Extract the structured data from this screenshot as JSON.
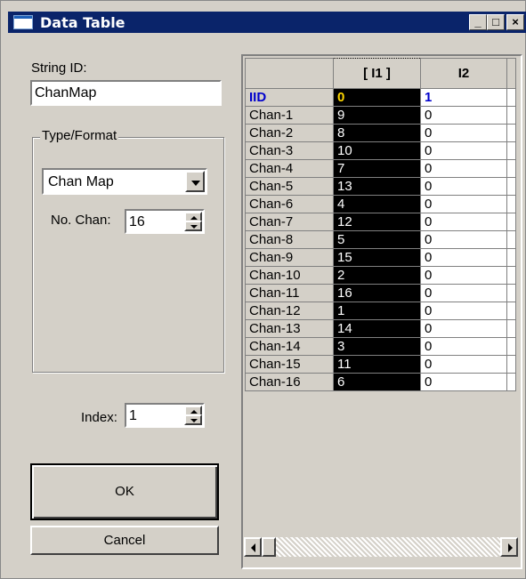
{
  "window": {
    "title": "Data Table",
    "buttons": {
      "minimize": "_",
      "maximize": "□",
      "close": "×"
    }
  },
  "left": {
    "string_id_label": "String ID:",
    "string_id_value": "ChanMap",
    "type_format_label": "Type/Format",
    "type_value": "Chan Map",
    "no_chan_label": "No. Chan:",
    "no_chan_value": "16",
    "index_label": "Index:",
    "index_value": "1",
    "ok_label": "OK",
    "cancel_label": "Cancel"
  },
  "grid": {
    "headers": [
      "",
      "[ I1 ]",
      "I2",
      ""
    ],
    "iid_row": {
      "label": "IID",
      "values": [
        "0",
        "1",
        ""
      ]
    },
    "rows": [
      {
        "label": "Chan-1",
        "i1": "9",
        "i2": "0",
        "i3": ""
      },
      {
        "label": "Chan-2",
        "i1": "8",
        "i2": "0",
        "i3": ""
      },
      {
        "label": "Chan-3",
        "i1": "10",
        "i2": "0",
        "i3": ""
      },
      {
        "label": "Chan-4",
        "i1": "7",
        "i2": "0",
        "i3": ""
      },
      {
        "label": "Chan-5",
        "i1": "13",
        "i2": "0",
        "i3": ""
      },
      {
        "label": "Chan-6",
        "i1": "4",
        "i2": "0",
        "i3": ""
      },
      {
        "label": "Chan-7",
        "i1": "12",
        "i2": "0",
        "i3": ""
      },
      {
        "label": "Chan-8",
        "i1": "5",
        "i2": "0",
        "i3": ""
      },
      {
        "label": "Chan-9",
        "i1": "15",
        "i2": "0",
        "i3": ""
      },
      {
        "label": "Chan-10",
        "i1": "2",
        "i2": "0",
        "i3": ""
      },
      {
        "label": "Chan-11",
        "i1": "16",
        "i2": "0",
        "i3": ""
      },
      {
        "label": "Chan-12",
        "i1": "1",
        "i2": "0",
        "i3": ""
      },
      {
        "label": "Chan-13",
        "i1": "14",
        "i2": "0",
        "i3": ""
      },
      {
        "label": "Chan-14",
        "i1": "3",
        "i2": "0",
        "i3": ""
      },
      {
        "label": "Chan-15",
        "i1": "11",
        "i2": "0",
        "i3": ""
      },
      {
        "label": "Chan-16",
        "i1": "6",
        "i2": "0",
        "i3": ""
      }
    ]
  },
  "colors": {
    "title_bar": "#0a246a",
    "face": "#d4d0c8",
    "selected_column": "#000000",
    "iid_value": "#0000cc",
    "iid_selected_value": "#ffd700"
  }
}
